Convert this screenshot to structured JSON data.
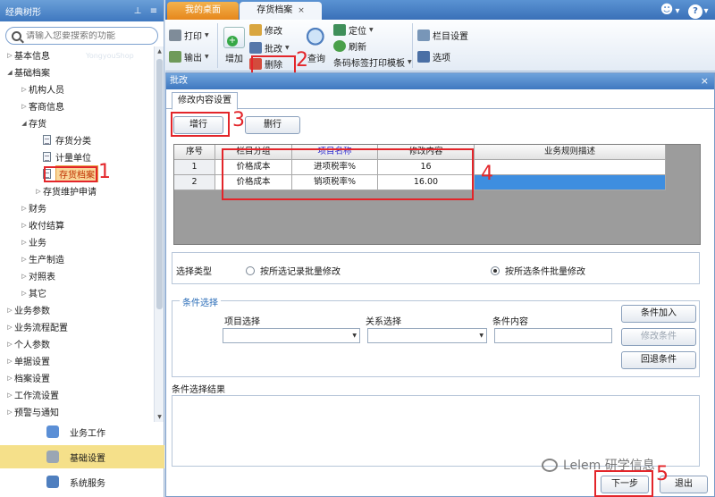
{
  "sidebar": {
    "title": "经典树形",
    "search_placeholder": "请输入您要搜索的功能",
    "watermark": "YongyouShop",
    "tree": [
      {
        "label": "基本信息",
        "level": 0,
        "expanded": false
      },
      {
        "label": "基础档案",
        "level": 0,
        "expanded": true
      },
      {
        "label": "机构人员",
        "level": 1,
        "expanded": false
      },
      {
        "label": "客商信息",
        "level": 1,
        "expanded": false
      },
      {
        "label": "存货",
        "level": 1,
        "expanded": true
      },
      {
        "label": "存货分类",
        "level": 2,
        "leaf": true
      },
      {
        "label": "计量单位",
        "level": 2,
        "leaf": true
      },
      {
        "label": "存货档案",
        "level": 2,
        "leaf": true,
        "selected": true
      },
      {
        "label": "存货维护申请",
        "level": 2,
        "expanded": false
      },
      {
        "label": "财务",
        "level": 1,
        "expanded": false
      },
      {
        "label": "收付结算",
        "level": 1,
        "expanded": false
      },
      {
        "label": "业务",
        "level": 1,
        "expanded": false
      },
      {
        "label": "生产制造",
        "level": 1,
        "expanded": false
      },
      {
        "label": "对照表",
        "level": 1,
        "expanded": false
      },
      {
        "label": "其它",
        "level": 1,
        "expanded": false
      },
      {
        "label": "业务参数",
        "level": 0,
        "expanded": false
      },
      {
        "label": "业务流程配置",
        "level": 0,
        "expanded": false
      },
      {
        "label": "个人参数",
        "level": 0,
        "expanded": false
      },
      {
        "label": "单据设置",
        "level": 0,
        "expanded": false
      },
      {
        "label": "档案设置",
        "level": 0,
        "expanded": false
      },
      {
        "label": "工作流设置",
        "level": 0,
        "expanded": false
      },
      {
        "label": "预警与通知",
        "level": 0,
        "expanded": false
      }
    ],
    "bottom_nav": [
      {
        "label": "业务工作",
        "color": "#5b8fd6"
      },
      {
        "label": "基础设置",
        "color": "#9aa6b4",
        "active": true
      },
      {
        "label": "系统服务",
        "color": "#4f7fbf"
      }
    ]
  },
  "tabs": {
    "desk": "我的桌面",
    "archive": "存货档案",
    "close_glyph": "×"
  },
  "top_tools": {
    "smile": "☻",
    "down": "▾",
    "help": "?",
    "dropdown": "▾"
  },
  "ribbon": {
    "print": "打印",
    "export": "输出",
    "add": "增加",
    "modify": "修改",
    "batch": "批改",
    "delete": "删除",
    "query": "查询",
    "locate": "定位",
    "refresh": "刷新",
    "barcode": "条码标签打印模板",
    "column_settings": "栏目设置",
    "options": "选项"
  },
  "dialog": {
    "title": "批改",
    "close_glyph": "×",
    "tab": "修改内容设置",
    "add_row": "增行",
    "del_row": "删行",
    "grid": {
      "headers": [
        "序号",
        "栏目分组",
        "项目名称",
        "修改内容",
        "业务规则描述"
      ],
      "rows": [
        [
          "1",
          "价格成本",
          "进项税率%",
          "16",
          ""
        ],
        [
          "2",
          "价格成本",
          "销项税率%",
          "16.00",
          ""
        ]
      ]
    },
    "select_type_label": "选择类型",
    "radio_by_record": "按所选记录批量修改",
    "radio_by_condition": "按所选条件批量修改",
    "condition_group": "条件选择",
    "item_select": "项目选择",
    "relation_select": "关系选择",
    "condition_content": "条件内容",
    "cond_add": "条件加入",
    "cond_modify": "修改条件",
    "cond_undo": "回退条件",
    "result_label": "条件选择结果",
    "next": "下一步",
    "exit": "退出"
  },
  "annotations": {
    "a1": "1",
    "a2": "2",
    "a3": "3",
    "a4": "4",
    "a5": "5"
  },
  "watermark": "Lelem 研学信息",
  "colors": {
    "annotation_red": "#e3252a",
    "selection_blue": "#3e8ee0",
    "header_blue": "#3f78c0",
    "desk_tab_orange": "#e6871c"
  }
}
